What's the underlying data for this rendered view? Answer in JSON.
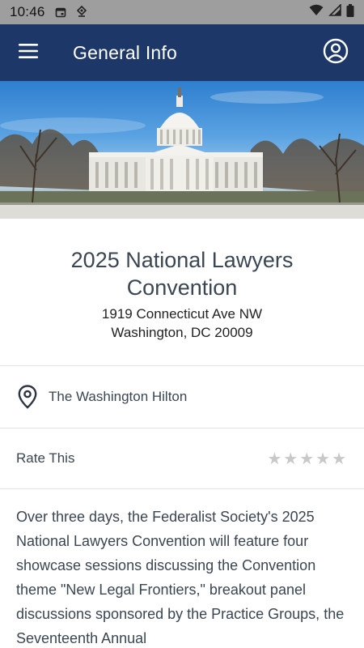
{
  "status_bar": {
    "time": "10:46",
    "icons": [
      "calendar-icon",
      "location-sync-icon",
      "wifi-icon",
      "signal-icon",
      "battery-icon"
    ]
  },
  "app_bar": {
    "title": "General Info",
    "background": "#1d3769",
    "icons": [
      "hamburger-menu-icon",
      "account-circle-icon"
    ]
  },
  "event": {
    "title": "2025 National Lawyers Convention",
    "address_line1": "1919 Connecticut Ave NW",
    "address_line2": "Washington, DC 20009",
    "venue": "The Washington Hilton",
    "venue_icon": "map-pin-icon"
  },
  "rating": {
    "label": "Rate This",
    "max_stars": 5,
    "current": 0,
    "star_glyph": "★"
  },
  "description": "Over three days, the Federalist Society's 2025 National Lawyers Convention will feature four showcase sessions discussing the Convention theme \"New Legal Frontiers,\" breakout panel discussions sponsored by the Practice Groups, the Seventeenth Annual"
}
